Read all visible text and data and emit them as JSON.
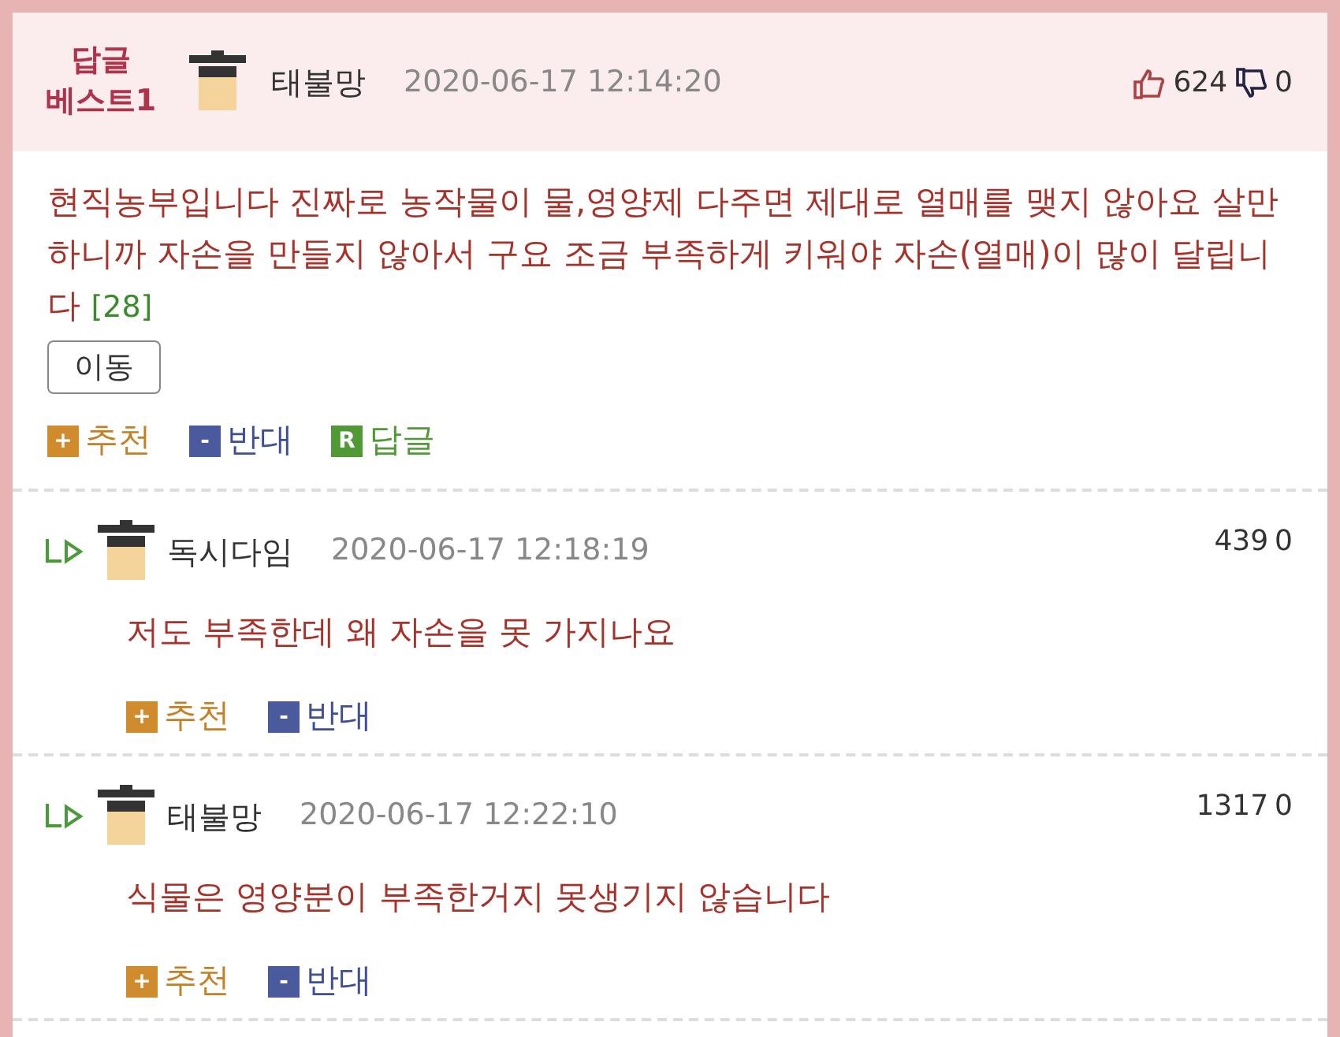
{
  "best_comment": {
    "badge_lines": [
      "답글",
      "베스트1"
    ],
    "author": "태불망",
    "timestamp": "2020-06-17 12:14:20",
    "likes": "624",
    "dislikes": "0",
    "body": "현직농부입니다 진짜로 농작물이 물,영양제 다주면 제대로 열매를 맺지 않아요 살만하니까 자손을 만들지 않아서 구요 조금 부족하게 키워야 자손(열매)이 많이 달립니다",
    "reply_count": "[28]",
    "move_button": "이동",
    "actions": [
      {
        "kind": "recommend",
        "icon": "+",
        "label": "추천"
      },
      {
        "kind": "oppose",
        "icon": "-",
        "label": "반대"
      },
      {
        "kind": "reply",
        "icon": "R",
        "label": "답글"
      }
    ]
  },
  "replies": [
    {
      "author": "독시다임",
      "timestamp": "2020-06-17 12:18:19",
      "likes": "439",
      "dislikes": "0",
      "body": "저도 부족한데 왜 자손을 못 가지나요",
      "actions": [
        {
          "kind": "recommend",
          "icon": "+",
          "label": "추천"
        },
        {
          "kind": "oppose",
          "icon": "-",
          "label": "반대"
        }
      ]
    },
    {
      "author": "태불망",
      "timestamp": "2020-06-17 12:22:10",
      "likes": "1317",
      "dislikes": "0",
      "body": "식물은 영양분이 부족한거지 못생기지 않습니다",
      "actions": [
        {
          "kind": "recommend",
          "icon": "+",
          "label": "추천"
        },
        {
          "kind": "oppose",
          "icon": "-",
          "label": "반대"
        }
      ]
    }
  ]
}
